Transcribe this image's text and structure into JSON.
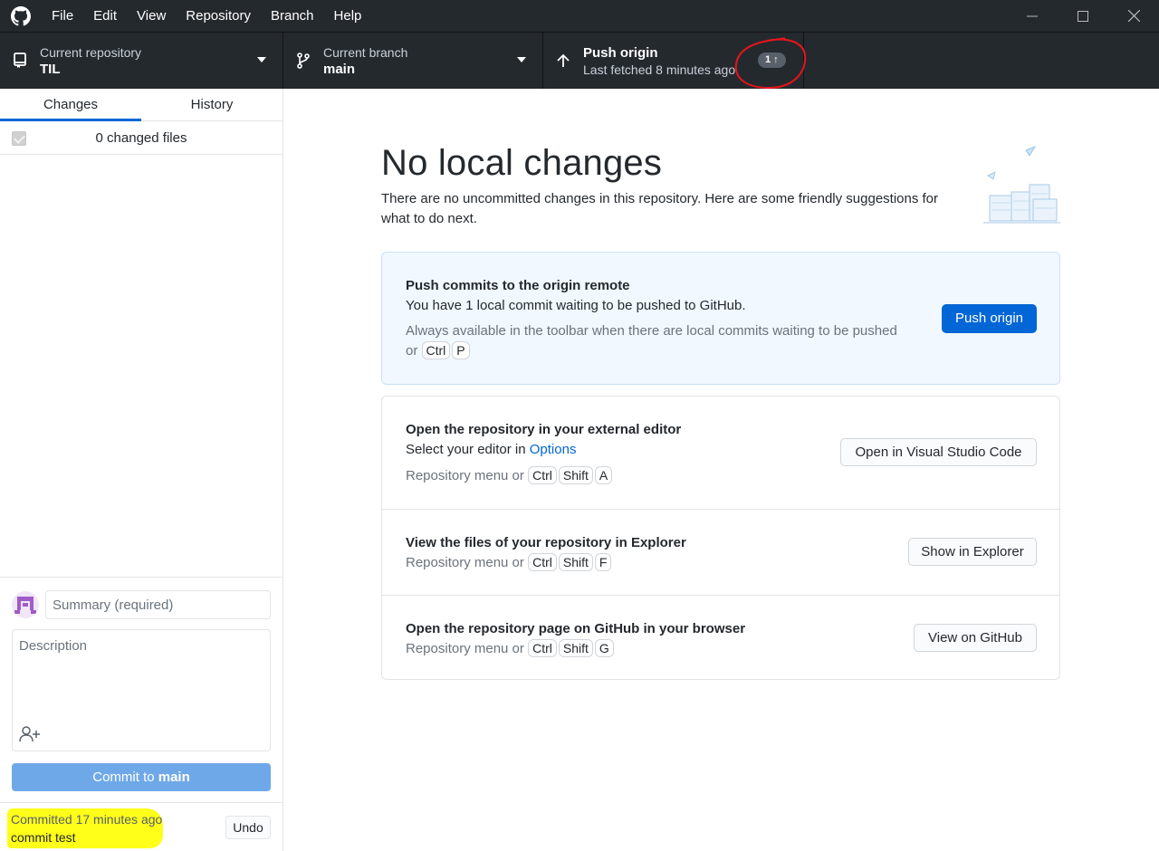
{
  "menu": [
    "File",
    "Edit",
    "View",
    "Repository",
    "Branch",
    "Help"
  ],
  "toolbar": {
    "repo_label": "Current repository",
    "repo_value": "TIL",
    "branch_label": "Current branch",
    "branch_value": "main",
    "push_title": "Push origin",
    "push_subtitle": "Last fetched 8 minutes ago",
    "push_badge": "1 ↑"
  },
  "sidebar": {
    "tabs": [
      "Changes",
      "History"
    ],
    "changed_files": "0 changed files",
    "summary_placeholder": "Summary (required)",
    "description_placeholder": "Description",
    "commit_prefix": "Commit to ",
    "commit_branch": "main",
    "last_commit_time": "Committed 17 minutes ago",
    "last_commit_message": "commit test",
    "undo_label": "Undo"
  },
  "main": {
    "heading": "No local changes",
    "subtext": "There are no uncommitted changes in this repository. Here are some friendly suggestions for what to do next.",
    "push_card": {
      "title": "Push commits to the origin remote",
      "desc": "You have 1 local commit waiting to be pushed to GitHub.",
      "hint": "Always available in the toolbar when there are local commits waiting to be pushed or",
      "keys": [
        "Ctrl",
        "P"
      ],
      "button": "Push origin"
    },
    "editor_card": {
      "title": "Open the repository in your external editor",
      "desc_prefix": "Select your editor in ",
      "desc_link": "Options",
      "hint": "Repository menu or",
      "keys": [
        "Ctrl",
        "Shift",
        "A"
      ],
      "button": "Open in Visual Studio Code"
    },
    "explorer_card": {
      "title": "View the files of your repository in Explorer",
      "hint": "Repository menu or",
      "keys": [
        "Ctrl",
        "Shift",
        "F"
      ],
      "button": "Show in Explorer"
    },
    "github_card": {
      "title": "Open the repository page on GitHub in your browser",
      "hint": "Repository menu or",
      "keys": [
        "Ctrl",
        "Shift",
        "G"
      ],
      "button": "View on GitHub"
    }
  },
  "colors": {
    "toolbar_bg": "#24292e",
    "accent": "#0366d6",
    "commit_button": "#6fa8e8",
    "highlight": "#ffff1a",
    "annotation": "#e8141c"
  }
}
